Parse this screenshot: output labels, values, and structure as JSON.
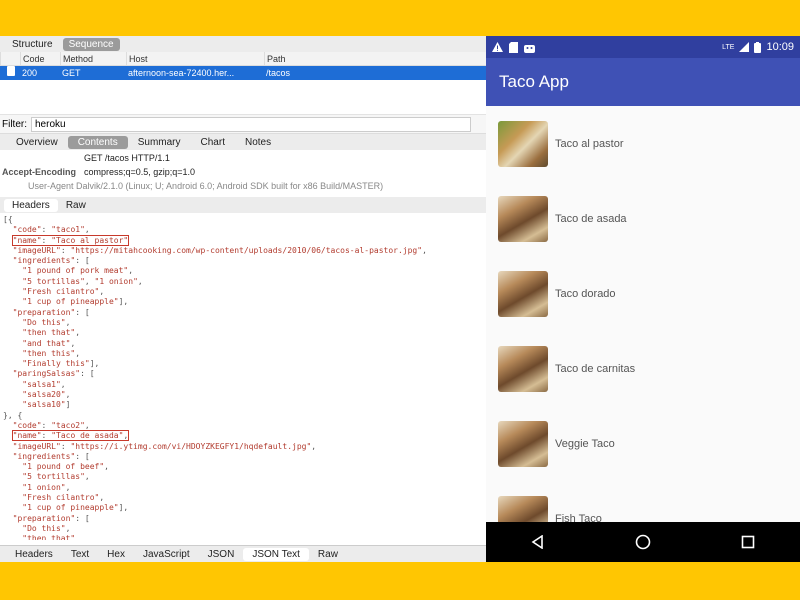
{
  "proxy": {
    "view_tabs": [
      "Structure",
      "Sequence"
    ],
    "columns": [
      "Code",
      "Method",
      "Host",
      "Path"
    ],
    "selected_row": {
      "code": "200",
      "method": "GET",
      "host": "afternoon-sea-72400.her...",
      "path": "/tacos"
    },
    "filter_label": "Filter:",
    "filter_value": "heroku",
    "detail_tabs": [
      "Overview",
      "Contents",
      "Summary",
      "Chart",
      "Notes"
    ],
    "request_line": "GET /tacos HTTP/1.1",
    "header_key": "Accept-Encoding",
    "header_value": "compress;q=0.5, gzip;q=1.0",
    "header_cut": "User-Agent   Dalvik/2.1.0 (Linux; U; Android 6.0; Android SDK built for x86 Build/MASTER)",
    "request_tabs": [
      "Headers",
      "Raw"
    ],
    "response_tabs": [
      "Headers",
      "Text",
      "Hex",
      "JavaScript",
      "JSON",
      "JSON Text",
      "Raw"
    ],
    "json_lines": [
      "[{",
      "  \"code\": \"taco1\",",
      "  \"name\": \"Taco al pastor\"",
      "  \"imageURL\": \"https://mitahcooking.com/wp-content/uploads/2010/06/tacos-al-pastor.jpg\",",
      "  \"ingredients\": [",
      "    \"1 pound of pork meat\",",
      "    \"5 tortillas\", \"1 onion\",",
      "    \"Fresh cilantro\",",
      "    \"1 cup of pineapple\"],",
      "  \"preparation\": [",
      "    \"Do this\",",
      "    \"then that\",",
      "    \"and that\",",
      "    \"then this\",",
      "    \"Finally this\"],",
      "  \"paringSalsas\": [",
      "    \"salsa1\",",
      "    \"salsa20\",",
      "    \"salsa10\"]",
      "}, {",
      "  \"code\": \"taco2\",",
      "  \"name\": \"Taco de asada\",",
      "  \"imageURL\": \"https://i.ytimg.com/vi/HDOYZKEGFY1/hqdefault.jpg\",",
      "  \"ingredients\": [",
      "    \"1 pound of beef\",",
      "    \"5 tortillas\",",
      "    \"1 onion\",",
      "    \"Fresh cilantro\",",
      "    \"1 cup of pineapple\"],",
      "  \"preparation\": [",
      "    \"Do this\",",
      "    \"then that\""
    ]
  },
  "phone": {
    "status_time": "10:09",
    "status_lte": "LTE",
    "app_title": "Taco App",
    "items": [
      "Taco al pastor",
      "Taco de asada",
      "Taco dorado",
      "Taco de carnitas",
      "Veggie Taco",
      "Fish Taco"
    ]
  }
}
